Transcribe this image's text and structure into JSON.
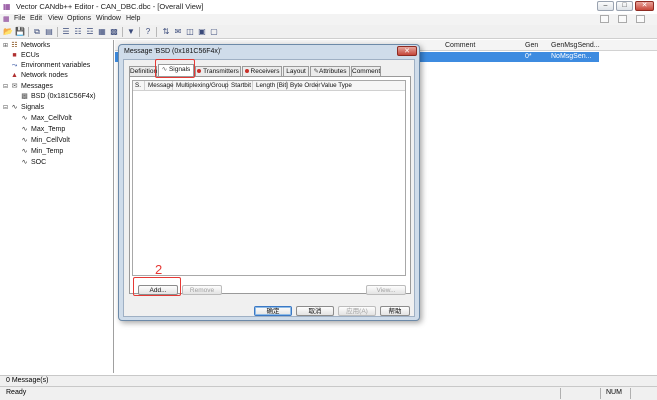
{
  "window": {
    "title": "Vector CANdb++ Editor - CAN_DBC.dbc - [Overall View]",
    "minimize_glyph": "–",
    "maximize_glyph": "□",
    "close_glyph": "✕"
  },
  "menu": {
    "items": [
      {
        "label": "File"
      },
      {
        "label": "Edit"
      },
      {
        "label": "View"
      },
      {
        "label": "Options"
      },
      {
        "label": "Window"
      },
      {
        "label": "Help"
      }
    ]
  },
  "tree": {
    "items": [
      {
        "label": "Networks",
        "icon": "networks-icon"
      },
      {
        "label": "ECUs",
        "icon": "ecu-icon"
      },
      {
        "label": "Environment variables",
        "icon": "env-var-icon"
      },
      {
        "label": "Network nodes",
        "icon": "network-node-icon"
      },
      {
        "label": "Messages",
        "icon": "messages-icon"
      },
      {
        "label": "BSD (0x181C56F4x)",
        "icon": "message-icon"
      },
      {
        "label": "Signals",
        "icon": "signals-icon"
      },
      {
        "label": "Max_CellVolt",
        "icon": "signal-icon"
      },
      {
        "label": "Max_Temp",
        "icon": "signal-icon"
      },
      {
        "label": "Min_CellVolt",
        "icon": "signal-icon"
      },
      {
        "label": "Min_Temp",
        "icon": "signal-icon"
      },
      {
        "label": "SOC",
        "icon": "signal-icon"
      }
    ]
  },
  "list": {
    "columns": [
      "Comment",
      "Gen",
      "GenMsgSend..."
    ],
    "selected_row": {
      "gen": "0*",
      "send_type": "NoMsgSen..."
    }
  },
  "dialog": {
    "title": "Message 'BSD (0x181C56F4x)'",
    "close_glyph": "✕",
    "tabs": [
      {
        "label": "Definition"
      },
      {
        "label": "Signals"
      },
      {
        "label": "Transmitters"
      },
      {
        "label": "Receivers"
      },
      {
        "label": "Layout"
      },
      {
        "label": "Attributes"
      },
      {
        "label": "Comment"
      }
    ],
    "grid_columns": [
      "S.",
      "Message",
      "Multiplexing/Group",
      "Startbit",
      "Length [Bit]",
      "Byte Order",
      "Value Type"
    ],
    "buttons": {
      "add": "Add...",
      "remove": "Remove",
      "view": "View..."
    },
    "footer_buttons": {
      "ok": "确定",
      "cancel": "取消",
      "apply": "应用(A)",
      "help": "帮助"
    },
    "annotation_number": "2"
  },
  "status": {
    "message_count": "0 Message(s)",
    "ready": "Ready",
    "num": "NUM"
  },
  "colors": {
    "selection": "#3d8be0",
    "annotation": "#e53935"
  }
}
